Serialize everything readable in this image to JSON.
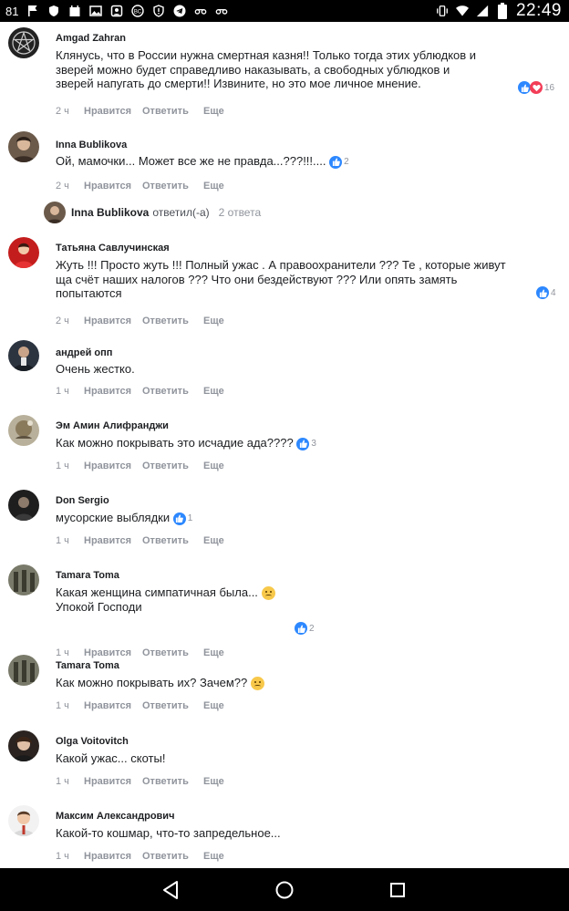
{
  "status_bar": {
    "left_text": "81",
    "left_icons": [
      "cellular-icon",
      "flag-icon",
      "shield-icon",
      "calendar-icon",
      "image-icon",
      "contacts-icon",
      "bc-icon",
      "shield-alert-icon",
      "telegram-icon",
      "link-icon",
      "link2-icon"
    ],
    "time": "22:49",
    "right_icons": [
      "vibrate-icon",
      "wifi-icon",
      "signal-icon",
      "battery-icon"
    ]
  },
  "comments": [
    {
      "author": "Amgad Zahran",
      "lines": [
        "Клянусь, что в России нужна смертная казня!! Только тогда этих ублюдков и",
        "зверей можно будет справедливо наказывать, а свободных ублюдков и",
        "зверей напугать до смерти!! Извините, но это мое личное мнение."
      ],
      "time": "2 ч",
      "reaction_count": "16"
    },
    {
      "author": "Inna Bublikova",
      "lines": [
        "Ой, мамочки... Может все же не правда...???!!!...."
      ],
      "time": "2 ч",
      "reaction_count": "2"
    },
    {
      "author": "Татьяна Савлучинская",
      "lines": [
        "Жуть !!! Просто жуть !!! Полный ужас . А правоохранители ??? Те , которые живут",
        "ща счёт наших налогов ??? Что они бездействуют ??? Или опять замять",
        "попытаются"
      ],
      "time": "2 ч",
      "reaction_count": "4"
    },
    {
      "author": "андрей опп",
      "lines": [
        "Очень жестко."
      ],
      "time": "1 ч",
      "reaction_count": ""
    },
    {
      "author": "Эм Амин Алифранджи",
      "lines": [
        "Как можно покрывать это исчадие ада????"
      ],
      "time": "1 ч",
      "reaction_count": "3"
    },
    {
      "author": "Don Sergio",
      "lines": [
        "мусорские выблядки"
      ],
      "time": "1 ч",
      "reaction_count": "1"
    },
    {
      "author": "Tamara Toma",
      "lines": [
        "Какая женщина симпатичная была...",
        "Упокой Господи"
      ],
      "time": "1 ч",
      "reaction_count": "2"
    },
    {
      "author": "Tamara Toma",
      "lines": [
        "Как можно покрывать их? Зачем??"
      ],
      "time": "1 ч",
      "reaction_count": ""
    },
    {
      "author": "Olga Voitovitch",
      "lines": [
        "Какой ужас... скоты!"
      ],
      "time": "1 ч",
      "reaction_count": ""
    },
    {
      "author": "Максим Александрович",
      "lines": [
        "Какой-то кошмар, что-то запредельное..."
      ],
      "time": "1 ч",
      "reaction_count": ""
    }
  ],
  "actions": {
    "like": "Нравится",
    "reply": "Ответить",
    "more": "Еще"
  },
  "replies_summary": {
    "name": "Inna Bublikova",
    "verb": "ответил(-а)",
    "count": "2 ответа"
  },
  "colors": {
    "like_blue": "#2d88ff",
    "love_red": "#f33e58",
    "meta_gray": "#90949c"
  }
}
